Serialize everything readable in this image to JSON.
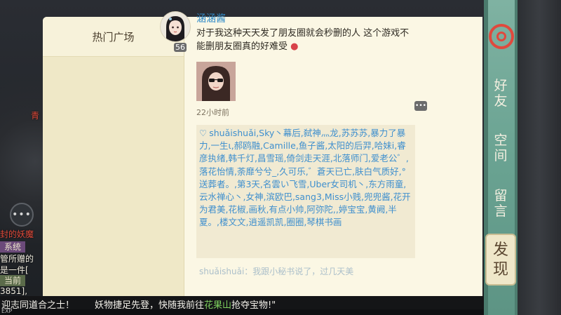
{
  "game": {
    "player_name": "青",
    "yao_label": "封的妖魔",
    "tags": {
      "system": "系统",
      "current": "当前"
    },
    "lines": [
      "管所赠的",
      "是一件[",
      "3851],"
    ],
    "bottom_message": {
      "prefix": "迎志同道合之士！",
      "middle": "妖物捷足先登，快随我前往",
      "place": "花果山",
      "suffix": "抢夺宝物!\""
    },
    "exp_label": "EXP"
  },
  "left_tab": {
    "label": "热门广场"
  },
  "post": {
    "author": "涵涵酱",
    "avatar_level": "56",
    "text": "对于我这种天天发了朋友圈就会秒删的人 这个游戏不能删朋友圈真的好难受",
    "time": "22小时前",
    "likes": "shuǎishuǎi,Sky丶幕后,弑神灬龙,苏苏苏,暴力了暴力,一生ι,郝鸥融,Camille,鱼子酱,太阳的后羿,哈妹i,睿彦执绪,韩千灯,昌雪瑶,倚剑走天涯,北落师门,爱老公゛,落花怡情,荼靡兮兮_,久可乐,゛蒼天已亡,肤白气质好,°送葬者。,第3天,名雲い飞雪,Uber女司机丶,东方雨童,云水禅心丶,女神,滨欧巴,sang3,Miss小贱,兜兜酱,花开为君美,花椒,画秋,有点小帅,阿弥陀,,婷宝宝,黄阙,半夏。,楼文文,逍遥凯凯,圈圈,琴棋书画",
    "next_comment": "shuǎishuǎi：我跟小秘书说了，过几天美"
  },
  "right_nav": {
    "friends": "好友",
    "space": "空间",
    "message": "留言",
    "discover": "发现"
  },
  "colors": {
    "accent": "#e0493d",
    "link": "#3e8fce",
    "panel": "#f2ecd0",
    "strip": "#6aa392"
  }
}
